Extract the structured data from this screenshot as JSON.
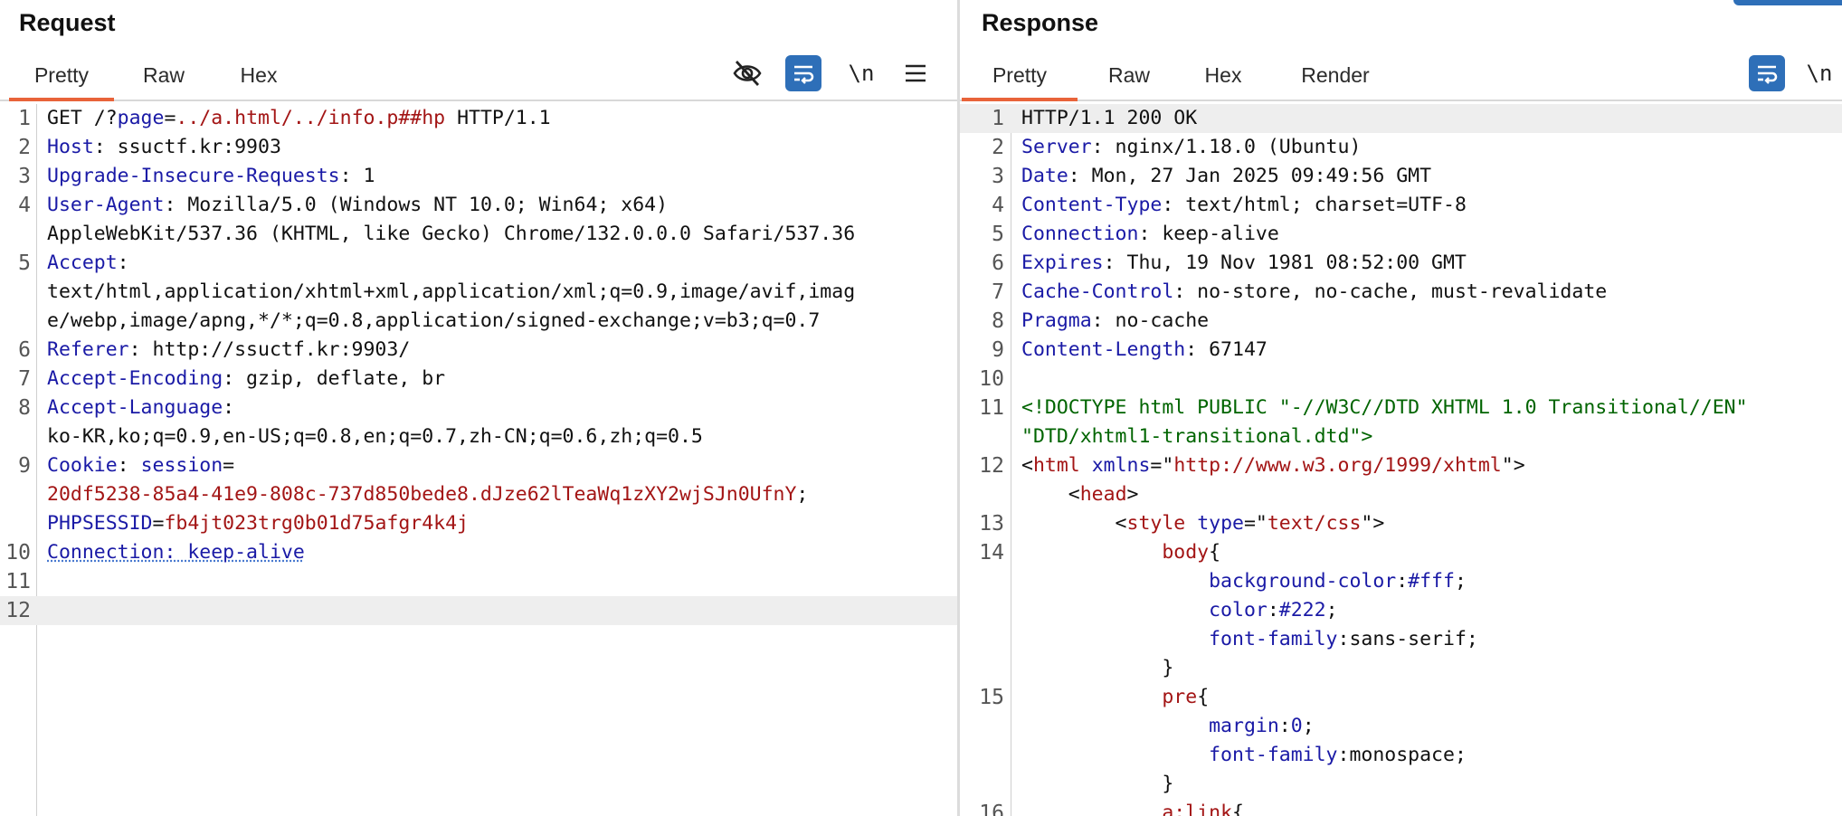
{
  "request": {
    "title": "Request",
    "tabs": [
      "Pretty",
      "Raw",
      "Hex"
    ],
    "active_tab": "Pretty",
    "tools": {
      "newline_label": "\\n"
    },
    "lines": [
      {
        "n": "1",
        "parts": [
          {
            "t": "GET /?",
            "c": "v"
          },
          {
            "t": "page",
            "c": "pl"
          },
          {
            "t": "=",
            "c": "v"
          },
          {
            "t": "../a.html/../info.p##hp",
            "c": "s"
          },
          {
            "t": " HTTP/1.1",
            "c": "v"
          }
        ]
      },
      {
        "n": "2",
        "parts": [
          {
            "t": "Host",
            "c": "k"
          },
          {
            "t": ": ssuctf.kr:9903",
            "c": "v"
          }
        ]
      },
      {
        "n": "3",
        "parts": [
          {
            "t": "Upgrade-Insecure-Requests",
            "c": "k"
          },
          {
            "t": ": 1",
            "c": "v"
          }
        ]
      },
      {
        "n": "4",
        "parts": [
          {
            "t": "User-Agent",
            "c": "k"
          },
          {
            "t": ": Mozilla/5.0 (Windows NT 10.0; Win64; x64)",
            "c": "v"
          }
        ]
      },
      {
        "n": "",
        "parts": [
          {
            "t": "AppleWebKit/537.36 (KHTML, like Gecko) Chrome/132.0.0.0 Safari/537.36",
            "c": "v"
          }
        ]
      },
      {
        "n": "5",
        "parts": [
          {
            "t": "Accept",
            "c": "k"
          },
          {
            "t": ":",
            "c": "v"
          }
        ]
      },
      {
        "n": "",
        "parts": [
          {
            "t": "text/html,application/xhtml+xml,application/xml;q=0.9,image/avif,imag",
            "c": "v"
          }
        ]
      },
      {
        "n": "",
        "parts": [
          {
            "t": "e/webp,image/apng,*/*;q=0.8,application/signed-exchange;v=b3;q=0.7",
            "c": "v"
          }
        ]
      },
      {
        "n": "6",
        "parts": [
          {
            "t": "Referer",
            "c": "k"
          },
          {
            "t": ": http://ssuctf.kr:9903/",
            "c": "v"
          }
        ]
      },
      {
        "n": "7",
        "parts": [
          {
            "t": "Accept-Encoding",
            "c": "k"
          },
          {
            "t": ": gzip, deflate, br",
            "c": "v"
          }
        ]
      },
      {
        "n": "8",
        "parts": [
          {
            "t": "Accept-Language",
            "c": "k"
          },
          {
            "t": ":",
            "c": "v"
          }
        ]
      },
      {
        "n": "",
        "parts": [
          {
            "t": "ko-KR,ko;q=0.9,en-US;q=0.8,en;q=0.7,zh-CN;q=0.6,zh;q=0.5",
            "c": "v"
          }
        ]
      },
      {
        "n": "9",
        "parts": [
          {
            "t": "Cookie",
            "c": "k"
          },
          {
            "t": ": ",
            "c": "v"
          },
          {
            "t": "session",
            "c": "pl"
          },
          {
            "t": "=",
            "c": "v"
          }
        ]
      },
      {
        "n": "",
        "parts": [
          {
            "t": "20df5238-85a4-41e9-808c-737d850bede8.dJze62lTeaWq1zXY2wjSJn0UfnY",
            "c": "s"
          },
          {
            "t": ";",
            "c": "v"
          }
        ]
      },
      {
        "n": "",
        "parts": [
          {
            "t": "PHPSESSID",
            "c": "pl"
          },
          {
            "t": "=",
            "c": "v"
          },
          {
            "t": "fb4jt023trg0b01d75afgr4k4j",
            "c": "s"
          }
        ]
      },
      {
        "n": "10",
        "parts": [
          {
            "t": "Connection: keep-alive",
            "c": "k dots"
          }
        ]
      },
      {
        "n": "11",
        "parts": []
      },
      {
        "n": "12",
        "parts": [],
        "highlight": true
      }
    ]
  },
  "response": {
    "title": "Response",
    "tabs": [
      "Pretty",
      "Raw",
      "Hex",
      "Render"
    ],
    "active_tab": "Pretty",
    "tools": {
      "newline_label": "\\n"
    },
    "lines": [
      {
        "n": "1",
        "parts": [
          {
            "t": "HTTP/1.1 200 OK",
            "c": "v"
          }
        ],
        "highlight": true
      },
      {
        "n": "2",
        "parts": [
          {
            "t": "Server",
            "c": "k"
          },
          {
            "t": ": nginx/1.18.0 (Ubuntu)",
            "c": "v"
          }
        ]
      },
      {
        "n": "3",
        "parts": [
          {
            "t": "Date",
            "c": "k"
          },
          {
            "t": ": Mon, 27 Jan 2025 09:49:56 GMT",
            "c": "v"
          }
        ]
      },
      {
        "n": "4",
        "parts": [
          {
            "t": "Content-Type",
            "c": "k"
          },
          {
            "t": ": text/html; charset=UTF-8",
            "c": "v"
          }
        ]
      },
      {
        "n": "5",
        "parts": [
          {
            "t": "Connection",
            "c": "k"
          },
          {
            "t": ": keep-alive",
            "c": "v"
          }
        ]
      },
      {
        "n": "6",
        "parts": [
          {
            "t": "Expires",
            "c": "k"
          },
          {
            "t": ": Thu, 19 Nov 1981 08:52:00 GMT",
            "c": "v"
          }
        ]
      },
      {
        "n": "7",
        "parts": [
          {
            "t": "Cache-Control",
            "c": "k"
          },
          {
            "t": ": no-store, no-cache, must-revalidate",
            "c": "v"
          }
        ]
      },
      {
        "n": "8",
        "parts": [
          {
            "t": "Pragma",
            "c": "k"
          },
          {
            "t": ": no-cache",
            "c": "v"
          }
        ]
      },
      {
        "n": "9",
        "parts": [
          {
            "t": "Content-Length",
            "c": "k"
          },
          {
            "t": ": 67147",
            "c": "v"
          }
        ]
      },
      {
        "n": "10",
        "parts": []
      },
      {
        "n": "11",
        "parts": [
          {
            "t": "<!DOCTYPE html PUBLIC \"-//W3C//DTD XHTML 1.0 Transitional//EN\"",
            "c": "g"
          }
        ]
      },
      {
        "n": "",
        "parts": [
          {
            "t": "\"DTD/xhtml1-transitional.dtd\">",
            "c": "g"
          }
        ]
      },
      {
        "n": "12",
        "parts": [
          {
            "t": "<",
            "c": "v"
          },
          {
            "t": "html",
            "c": "tg"
          },
          {
            "t": " ",
            "c": "v"
          },
          {
            "t": "xmlns",
            "c": "at"
          },
          {
            "t": "=\"",
            "c": "v"
          },
          {
            "t": "http://www.w3.org/1999/xhtml",
            "c": "s"
          },
          {
            "t": "\">",
            "c": "v"
          }
        ]
      },
      {
        "n": "",
        "parts": [
          {
            "t": "    <",
            "c": "v"
          },
          {
            "t": "head",
            "c": "tg"
          },
          {
            "t": ">",
            "c": "v"
          }
        ]
      },
      {
        "n": "13",
        "parts": [
          {
            "t": "        <",
            "c": "v"
          },
          {
            "t": "style",
            "c": "tg"
          },
          {
            "t": " ",
            "c": "v"
          },
          {
            "t": "type",
            "c": "at"
          },
          {
            "t": "=\"",
            "c": "v"
          },
          {
            "t": "text/css",
            "c": "s"
          },
          {
            "t": "\">",
            "c": "v"
          }
        ]
      },
      {
        "n": "14",
        "parts": [
          {
            "t": "            ",
            "c": "v"
          },
          {
            "t": "body",
            "c": "tg"
          },
          {
            "t": "{",
            "c": "v"
          }
        ]
      },
      {
        "n": "",
        "parts": [
          {
            "t": "                ",
            "c": "v"
          },
          {
            "t": "background-color",
            "c": "at"
          },
          {
            "t": ":",
            "c": "v"
          },
          {
            "t": "#fff",
            "c": "at"
          },
          {
            "t": ";",
            "c": "v"
          }
        ]
      },
      {
        "n": "",
        "parts": [
          {
            "t": "                ",
            "c": "v"
          },
          {
            "t": "color",
            "c": "at"
          },
          {
            "t": ":",
            "c": "v"
          },
          {
            "t": "#222",
            "c": "at"
          },
          {
            "t": ";",
            "c": "v"
          }
        ]
      },
      {
        "n": "",
        "parts": [
          {
            "t": "                ",
            "c": "v"
          },
          {
            "t": "font-family",
            "c": "at"
          },
          {
            "t": ":sans-serif;",
            "c": "v"
          }
        ]
      },
      {
        "n": "",
        "parts": [
          {
            "t": "            }",
            "c": "v"
          }
        ]
      },
      {
        "n": "15",
        "parts": [
          {
            "t": "            ",
            "c": "v"
          },
          {
            "t": "pre",
            "c": "tg"
          },
          {
            "t": "{",
            "c": "v"
          }
        ]
      },
      {
        "n": "",
        "parts": [
          {
            "t": "                ",
            "c": "v"
          },
          {
            "t": "margin",
            "c": "at"
          },
          {
            "t": ":",
            "c": "v"
          },
          {
            "t": "0",
            "c": "at"
          },
          {
            "t": ";",
            "c": "v"
          }
        ]
      },
      {
        "n": "",
        "parts": [
          {
            "t": "                ",
            "c": "v"
          },
          {
            "t": "font-family",
            "c": "at"
          },
          {
            "t": ":monospace;",
            "c": "v"
          }
        ]
      },
      {
        "n": "",
        "parts": [
          {
            "t": "            }",
            "c": "v"
          }
        ]
      },
      {
        "n": "16",
        "parts": [
          {
            "t": "            ",
            "c": "v"
          },
          {
            "t": "a:link",
            "c": "tg"
          },
          {
            "t": "{",
            "c": "v"
          }
        ]
      }
    ]
  }
}
